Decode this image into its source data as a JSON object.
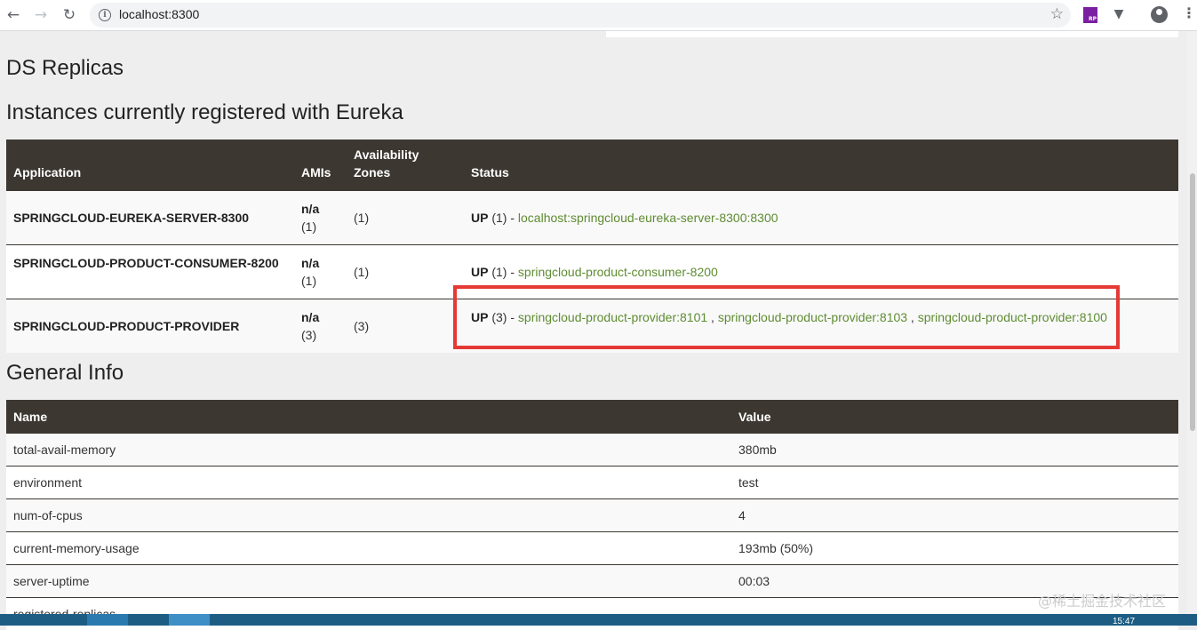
{
  "browser": {
    "url": "localhost:8300"
  },
  "page": {
    "replicas_heading": "DS Replicas",
    "instances_heading": "Instances currently registered with Eureka",
    "general_heading": "General Info"
  },
  "instances_table": {
    "headers": {
      "application": "Application",
      "amis": "AMIs",
      "zones": "Availability Zones",
      "status": "Status"
    },
    "rows": [
      {
        "application": "SPRINGCLOUD-EUREKA-SERVER-8300",
        "amis": "n/a",
        "amis_count": "(1)",
        "zones": "(1)",
        "status_up": "UP",
        "status_count": " (1) - ",
        "links": [
          "localhost:springcloud-eureka-server-8300:8300"
        ]
      },
      {
        "application": "SPRINGCLOUD-PRODUCT-CONSUMER-8200",
        "amis": "n/a",
        "amis_count": "(1)",
        "zones": "(1)",
        "status_up": "UP",
        "status_count": " (1) - ",
        "links": [
          "springcloud-product-consumer-8200"
        ]
      },
      {
        "application": "SPRINGCLOUD-PRODUCT-PROVIDER",
        "amis": "n/a",
        "amis_count": "(3)",
        "zones": "(3)",
        "status_up": "UP",
        "status_count": " (3) - ",
        "links": [
          "springcloud-product-provider:8101",
          "springcloud-product-provider:8103",
          "springcloud-product-provider:8100"
        ]
      }
    ]
  },
  "general_table": {
    "headers": {
      "name": "Name",
      "value": "Value"
    },
    "rows": [
      {
        "name": "total-avail-memory",
        "value": "380mb"
      },
      {
        "name": "environment",
        "value": "test"
      },
      {
        "name": "num-of-cpus",
        "value": "4"
      },
      {
        "name": "current-memory-usage",
        "value": "193mb (50%)"
      },
      {
        "name": "server-uptime",
        "value": "00:03"
      },
      {
        "name": "registered-replicas",
        "value": ""
      }
    ]
  },
  "taskbar": {
    "clock": "15:47"
  },
  "watermark": "@稀土掘金技术社区",
  "colors": {
    "header_bg": "#3c3731",
    "link": "#5e8c31",
    "highlight": "#e53935"
  }
}
